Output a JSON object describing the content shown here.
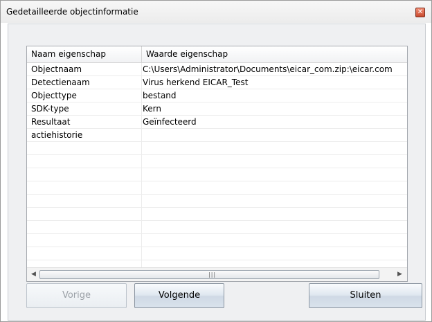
{
  "dialog": {
    "title": "Gedetailleerde objectinformatie",
    "close_glyph": "✕"
  },
  "table": {
    "headers": [
      "Naam eigenschap",
      "Waarde eigenschap"
    ],
    "rows": [
      {
        "name": "Objectnaam",
        "value": "C:\\Users\\Administrator\\Documents\\eicar_com.zip:\\eicar.com"
      },
      {
        "name": "Detectienaam",
        "value": "Virus herkend EICAR_Test"
      },
      {
        "name": "Objecttype",
        "value": "bestand"
      },
      {
        "name": "SDK-type",
        "value": "Kern"
      },
      {
        "name": "Resultaat",
        "value": "Geïnfecteerd"
      },
      {
        "name": "actiehistorie",
        "value": ""
      },
      {
        "name": "",
        "value": ""
      },
      {
        "name": "",
        "value": ""
      },
      {
        "name": "",
        "value": ""
      },
      {
        "name": "",
        "value": ""
      },
      {
        "name": "",
        "value": ""
      },
      {
        "name": "",
        "value": ""
      },
      {
        "name": "",
        "value": ""
      },
      {
        "name": "",
        "value": ""
      },
      {
        "name": "",
        "value": ""
      }
    ]
  },
  "scrollbar": {
    "left_arrow": "◀",
    "right_arrow": "▶",
    "grip": "|||"
  },
  "buttons": {
    "previous": "Vorige",
    "next": "Volgende",
    "close": "Sluiten"
  },
  "colors": {
    "client_bg": "#eff0f2",
    "close_button": "#c84a2e"
  }
}
